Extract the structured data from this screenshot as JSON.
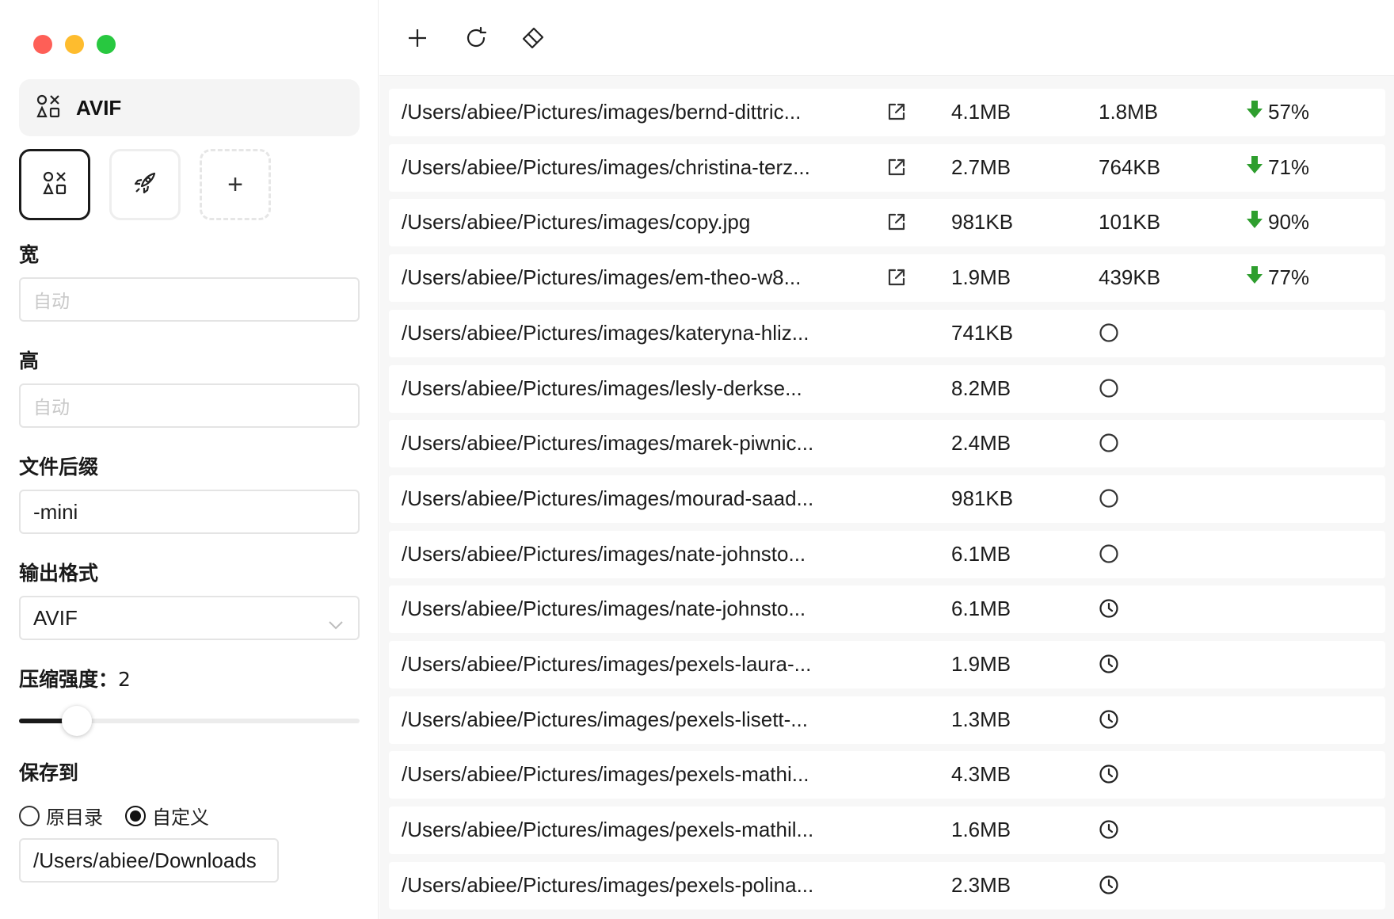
{
  "window": {
    "traffic_lights": [
      "close",
      "minimize",
      "zoom"
    ]
  },
  "sidebar": {
    "preset_header": {
      "icon": "shapes-icon",
      "label": "AVIF"
    },
    "preset_tiles": [
      {
        "icon": "shapes-icon",
        "active": true
      },
      {
        "icon": "rocket-icon",
        "active": false
      },
      {
        "icon": "plus-icon",
        "label": "+"
      }
    ],
    "width": {
      "label": "宽",
      "placeholder": "自动"
    },
    "height": {
      "label": "高",
      "placeholder": "自动"
    },
    "suffix": {
      "label": "文件后缀",
      "value": "-mini"
    },
    "format": {
      "label": "输出格式",
      "value": "AVIF"
    },
    "compression": {
      "label": "压缩强度：",
      "value": "2",
      "level": 0.14
    },
    "save_to": {
      "label": "保存到",
      "options": [
        "原目录",
        "自定义"
      ],
      "selected": "自定义",
      "path": "/Users/abiee/Downloads"
    }
  },
  "toolbar": {
    "buttons": [
      "plus-icon",
      "refresh-icon",
      "eraser-icon"
    ]
  },
  "files": [
    {
      "path": "/Users/abiee/Pictures/images/bernd-dittric...",
      "original": "4.1MB",
      "compressed": "1.8MB",
      "saving": "57%",
      "status": "done"
    },
    {
      "path": "/Users/abiee/Pictures/images/christina-terz...",
      "original": "2.7MB",
      "compressed": "764KB",
      "saving": "71%",
      "status": "done"
    },
    {
      "path": "/Users/abiee/Pictures/images/copy.jpg",
      "original": "981KB",
      "compressed": "101KB",
      "saving": "90%",
      "status": "done"
    },
    {
      "path": "/Users/abiee/Pictures/images/em-theo-w8...",
      "original": "1.9MB",
      "compressed": "439KB",
      "saving": "77%",
      "status": "done"
    },
    {
      "path": "/Users/abiee/Pictures/images/kateryna-hliz...",
      "original": "741KB",
      "status": "processing"
    },
    {
      "path": "/Users/abiee/Pictures/images/lesly-derkse...",
      "original": "8.2MB",
      "status": "processing"
    },
    {
      "path": "/Users/abiee/Pictures/images/marek-piwnic...",
      "original": "2.4MB",
      "status": "processing"
    },
    {
      "path": "/Users/abiee/Pictures/images/mourad-saad...",
      "original": "981KB",
      "status": "processing"
    },
    {
      "path": "/Users/abiee/Pictures/images/nate-johnsto...",
      "original": "6.1MB",
      "status": "processing"
    },
    {
      "path": "/Users/abiee/Pictures/images/nate-johnsto...",
      "original": "6.1MB",
      "status": "pending"
    },
    {
      "path": "/Users/abiee/Pictures/images/pexels-laura-...",
      "original": "1.9MB",
      "status": "pending"
    },
    {
      "path": "/Users/abiee/Pictures/images/pexels-lisett-...",
      "original": "1.3MB",
      "status": "pending"
    },
    {
      "path": "/Users/abiee/Pictures/images/pexels-mathi...",
      "original": "4.3MB",
      "status": "pending"
    },
    {
      "path": "/Users/abiee/Pictures/images/pexels-mathil...",
      "original": "1.6MB",
      "status": "pending"
    },
    {
      "path": "/Users/abiee/Pictures/images/pexels-polina...",
      "original": "2.3MB",
      "status": "pending"
    }
  ],
  "colors": {
    "saving_arrow": "#2e9e2e",
    "accent": "#1a1a1a"
  }
}
